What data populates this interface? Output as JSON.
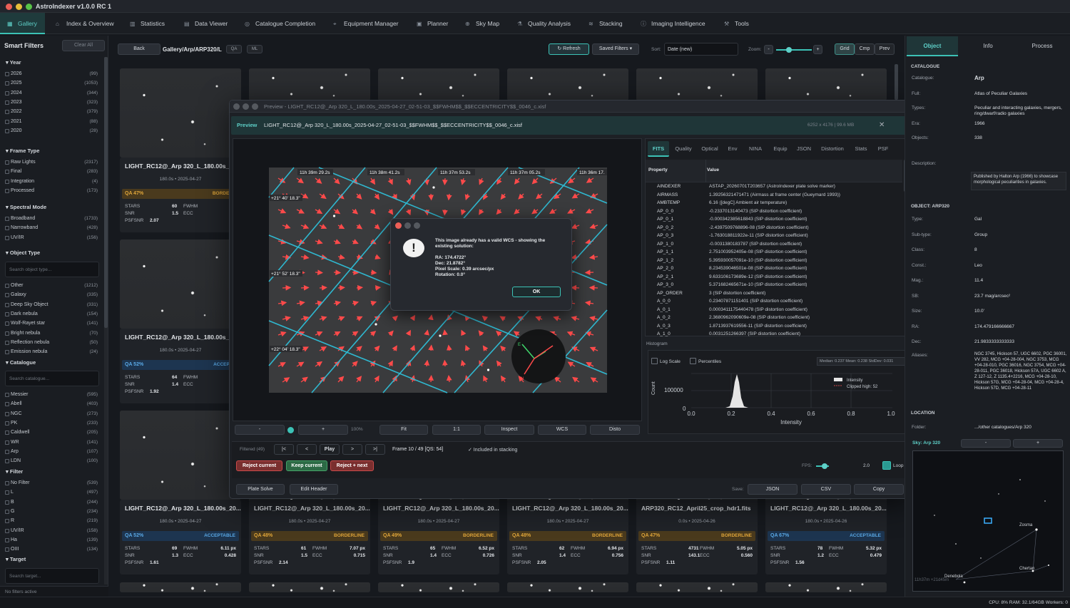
{
  "app": {
    "title": "AstroIndexer v1.0.0 RC 1"
  },
  "tabs": [
    {
      "label": "Gallery",
      "icon": "grid-icon"
    },
    {
      "label": "Index & Overview",
      "icon": "home-icon"
    },
    {
      "label": "Statistics",
      "icon": "bars-icon"
    },
    {
      "label": "Data Viewer",
      "icon": "doc-icon"
    },
    {
      "label": "Catalogue Completion",
      "icon": "target-icon"
    },
    {
      "label": "Equipment Manager",
      "icon": "telescope-icon"
    },
    {
      "label": "Planner",
      "icon": "calendar-icon"
    },
    {
      "label": "Sky Map",
      "icon": "globe-icon"
    },
    {
      "label": "Quality Analysis",
      "icon": "flask-icon"
    },
    {
      "label": "Stacking",
      "icon": "layers-icon"
    },
    {
      "label": "Imaging Intelligence",
      "icon": "info-icon"
    },
    {
      "label": "Tools",
      "icon": "wrench-icon"
    }
  ],
  "sidebar": {
    "title": "Smart Filters",
    "clear_all": "Clear All",
    "year": {
      "label": "Year",
      "items": [
        [
          "2026",
          "(99)"
        ],
        [
          "2025",
          "(1053)"
        ],
        [
          "2024",
          "(344)"
        ],
        [
          "2023",
          "(323)"
        ],
        [
          "2022",
          "(379)"
        ],
        [
          "2021",
          "(88)"
        ],
        [
          "2020",
          "(28)"
        ]
      ]
    },
    "frame_type": {
      "label": "Frame Type",
      "items": [
        [
          "Raw Lights",
          "(2317)"
        ],
        [
          "Final",
          "(283)"
        ],
        [
          "Integration",
          "(4)"
        ],
        [
          "Processed",
          "(173)"
        ]
      ]
    },
    "spectral": {
      "label": "Spectral Mode",
      "items": [
        [
          "Broadband",
          "(1733)"
        ],
        [
          "Narrowband",
          "(428)"
        ],
        [
          "UV/IR",
          "(156)"
        ]
      ]
    },
    "object_type": {
      "label": "Object Type",
      "search": "Search object type...",
      "items": [
        [
          "Other",
          "(1212)"
        ],
        [
          "Galaxy",
          "(335)"
        ],
        [
          "Deep Sky Object",
          "(331)"
        ],
        [
          "Dark nebula",
          "(154)"
        ],
        [
          "Wolf-Rayet star",
          "(141)"
        ],
        [
          "Bright nebula",
          "(70)"
        ],
        [
          "Reflection nebula",
          "(50)"
        ],
        [
          "Emission nebula",
          "(24)"
        ]
      ]
    },
    "catalogue": {
      "label": "Catalogue",
      "search": "Search catalogue...",
      "items": [
        [
          "Messier",
          "(595)"
        ],
        [
          "Abell",
          "(403)"
        ],
        [
          "NGC",
          "(273)"
        ],
        [
          "PK",
          "(233)"
        ],
        [
          "Caldwell",
          "(205)"
        ],
        [
          "WR",
          "(141)"
        ],
        [
          "Arp",
          "(107)"
        ],
        [
          "LDN",
          "(100)"
        ]
      ]
    },
    "filter": {
      "label": "Filter",
      "items": [
        [
          "No Filter",
          "(539)"
        ],
        [
          "L",
          "(497)"
        ],
        [
          "B",
          "(244)"
        ],
        [
          "G",
          "(234)"
        ],
        [
          "R",
          "(219)"
        ],
        [
          "UV/IR",
          "(158)"
        ],
        [
          "Ha",
          "(139)"
        ],
        [
          "OIII",
          "(134)"
        ]
      ]
    },
    "target": {
      "label": "Target",
      "search": "Search target..."
    },
    "footer": "No filters active"
  },
  "toolbar": {
    "back": "Back",
    "path": "Gallery/Arp/ARP320/L",
    "qa": "QA",
    "ml": "ML",
    "refresh": "Refresh",
    "saved_filters": "Saved Filters",
    "sort_label": "Sort:",
    "sort_value": "Date (new)",
    "zoom_label": "Zoom:",
    "zoom_minus": "-",
    "zoom_plus": "+",
    "grid": "Grid",
    "cmp": "Cmp",
    "prev": "Prev"
  },
  "cards_left": [
    {
      "name": "LIGHT_RC12@_Arp 320_L_180.00s_2",
      "sub": "180.0s • 2025-04-27",
      "qa": "QA 47%",
      "status": "BORDERL",
      "stars": "60",
      "fwhm": "6.",
      "snr": "1.5",
      "ecc": "",
      "psfsnr": "2.07"
    },
    {
      "name": "LIGHT_RC12@_Arp 320_L_180.00s_2",
      "sub": "180.0s • 2025-04-27",
      "qa": "QA 52%",
      "status": "ACCEPTA",
      "stars": "64",
      "fwhm": "6.",
      "snr": "1.4",
      "ecc": "",
      "psfsnr": "1.92"
    },
    {
      "name": "LIGHT_RC12@_Arp 320_L_180.00s_20...",
      "sub": "180.0s • 2025-04-27",
      "qa": "QA 52%",
      "status": "ACCEPTABLE",
      "stars": "69",
      "fwhm": "6.11 px",
      "snr": "1.3",
      "ecc": "0.428",
      "psfsnr": "1.61"
    }
  ],
  "cards_bottom": [
    {
      "name": "LIGHT_RC12@_Arp 320_L_180.00s_20...",
      "sub": "180.0s • 2025-04-27",
      "qa": "QA 48%",
      "status": "BORDERLINE",
      "stars": "61",
      "fwhm": "7.07 px",
      "snr": "1.5",
      "ecc": "0.715",
      "psfsnr": "2.14"
    },
    {
      "name": "LIGHT_RC12@_Arp 320_L_180.00s_20...",
      "sub": "180.0s • 2025-04-27",
      "qa": "QA 49%",
      "status": "BORDERLINE",
      "stars": "65",
      "fwhm": "6.52 px",
      "snr": "1.4",
      "ecc": "0.726",
      "psfsnr": "1.9"
    },
    {
      "name": "LIGHT_RC12@_Arp 320_L_180.00s_20...",
      "sub": "180.0s • 2025-04-27",
      "qa": "QA 48%",
      "status": "BORDERLINE",
      "stars": "62",
      "fwhm": "6.94 px",
      "snr": "1.4",
      "ecc": "0.756",
      "psfsnr": "2.05"
    },
    {
      "name": "ARP320_RC12_April25_crop_hdr1.fits",
      "sub": "0.0s • 2025-04-26",
      "qa": "QA 47%",
      "status": "BORDERLINE",
      "stars": "4731",
      "fwhm": "5.05 px",
      "snr": "143.1",
      "ecc": "0.560",
      "psfsnr": "1.11"
    },
    {
      "name": "LIGHT_RC12@_Arp 320_L_180.00s_20...",
      "sub": "180.0s • 2025-04-26",
      "qa": "QA 67%",
      "status": "ACCEPTABLE",
      "stars": "78",
      "fwhm": "5.32 px",
      "snr": "1.2",
      "ecc": "0.479",
      "psfsnr": "1.56"
    }
  ],
  "stat_labels": {
    "stars": "STARS",
    "fwhm": "FWHM",
    "snr": "SNR",
    "ecc": "ECC",
    "psfsnr": "PSFSNR"
  },
  "preview": {
    "window_title": "Preview - LIGHT_RC12@_Arp 320_L_180.00s_2025-04-27_02-51-03_$$FWHM$$_$$ECCENTRICITY$$_0046_c.xisf",
    "badge": "Preview",
    "filename": "LIGHT_RC12@_Arp 320_L_180.00s_2025-04-27_02-51-03_$$FWHM$$_$$ECCENTRICITY$$_0046_c.xisf",
    "dims": "6252 x 4176 | 99.6 MB",
    "ra_labels": [
      "11h 39m 29.2s",
      "11h 38m 41.2s",
      "11h 37m 53.2s",
      "11h 37m 05.2s",
      "11h 36m 17."
    ],
    "dec_labels": [
      "+21° 40' 18.3\"",
      "+21° 52' 18.3\"",
      "+22° 04' 18.3\""
    ],
    "dialog": {
      "message": "This image already has a valid WCS - showing the existing solution:",
      "ra": "RA: 174.4722°",
      "dec": "Dec: 21.8782°",
      "scale": "Pixel Scale: 0.39 arcsec/px",
      "rotation": "Rotation: 0.0°",
      "ok": "OK"
    },
    "view_buttons": {
      "minus": "-",
      "plus": "+",
      "zoom": "100%",
      "fit": "Fit",
      "one": "1:1",
      "inspect": "Inspect",
      "wcs": "WCS",
      "disto": "Disto"
    },
    "playback": {
      "filtered": "Filtered (49)",
      "first": "|<",
      "prev": "<",
      "play": "Play",
      "next": ">",
      "last": ">|",
      "frame": "Frame 10 / 49  [QS: 54]",
      "included": "✓ Included in stacking"
    },
    "actions": {
      "reject": "Reject current",
      "keep": "Keep current",
      "reject_next": "Reject + next",
      "fps_label": "FPS:",
      "fps": "2.0",
      "loop": "Loop"
    },
    "bottom": {
      "plate_solve": "Plate Solve",
      "edit_header": "Edit Header",
      "save_label": "Save:",
      "json": "JSON",
      "csv": "CSV",
      "copy": "Copy"
    },
    "tabs": [
      "FITS",
      "Quality",
      "Optical",
      "Env",
      "NINA",
      "Equip",
      "JSON",
      "Distortion",
      "Stats",
      "PSF"
    ],
    "table_headers": [
      "Property",
      "Value"
    ],
    "fits_rows": [
      [
        "AINDEXER",
        "ASTAP_20260701T203657 (AstroIndexer plate solve marker)"
      ],
      [
        "AIRMASS",
        "1.39256321471471 (Airmass at frame center (Gueymard 1993))"
      ],
      [
        "AMBTEMP",
        "6.16 ([degC] Ambient air temperature)"
      ],
      [
        "AP_0_0",
        "-0.2337013140473 (SIP distortion coefficient)"
      ],
      [
        "AP_0_1",
        "-0.000342385618843 (SIP distortion coefficient)"
      ],
      [
        "AP_0_2",
        "-2.4397509768896-08 (SIP distortion coefficient)"
      ],
      [
        "AP_0_3",
        "-1.763018811922e-11 (SIP distortion coefficient)"
      ],
      [
        "AP_1_0",
        "-0.0031380183787 (SIP distortion coefficient)"
      ],
      [
        "AP_1_1",
        "2.751003952405e-08 (SIP distortion coefficient)"
      ],
      [
        "AP_1_2",
        "5.395930057091e-10 (SIP distortion coefficient)"
      ],
      [
        "AP_2_0",
        "8.234539046501e-08 (SIP distortion coefficient)"
      ],
      [
        "AP_2_1",
        "9.633106173689e-12 (SIP distortion coefficient)"
      ],
      [
        "AP_3_0",
        "5.371682465671e-10 (SIP distortion coefficient)"
      ],
      [
        "AP_ORDER",
        "3 (SIP distortion coefficient)"
      ],
      [
        "A_0_0",
        "0.23407871151401 (SIP distortion coefficient)"
      ],
      [
        "A_0_1",
        "0.0003411175440478 (SIP distortion coefficient)"
      ],
      [
        "A_0_2",
        "2.3680962090609e-08 (SIP distortion coefficient)"
      ],
      [
        "A_0_3",
        "1.8713937619556-11 (SIP distortion coefficient)"
      ],
      [
        "A_1_0",
        "0.0031251266397 (SIP distortion coefficient)"
      ]
    ],
    "histogram": {
      "title": "Histogram",
      "log_scale": "Log Scale",
      "percentiles": "Percentiles",
      "stats": "Median: 0.237  Mean: 0.238  StdDev: 0.031",
      "ylabel": "Count",
      "xlabel": "Intensity",
      "ytick": "100000",
      "ytick0": "0",
      "xticks": [
        "0.0",
        "0.2",
        "0.4",
        "0.6",
        "0.8",
        "1.0"
      ],
      "legend_intensity": "Intensity",
      "legend_clipped": "Clipped high: 52"
    }
  },
  "right_panel": {
    "tabs": [
      "Object",
      "Info",
      "Process"
    ],
    "catalogue_section": "CATALOGUE",
    "catalogue_rows": [
      [
        "Catalogue:",
        "Arp"
      ],
      [
        "Full:",
        "Atlas of Peculiar Galaxies"
      ],
      [
        "Types:",
        "Peculiar and interacting galaxies, mergers, ring/dwarf/radio galaxies"
      ],
      [
        "Era:",
        "1966"
      ],
      [
        "Objects:",
        "338"
      ]
    ],
    "description_label": "Description:",
    "description": "Published by Halton Arp (1966) to showcase morphological peculiarities in galaxies.",
    "object_section": "OBJECT: ARP320",
    "object_rows": [
      [
        "Type:",
        "Gal"
      ],
      [
        "Sub-type:",
        "Group"
      ],
      [
        "Class:",
        "8"
      ],
      [
        "Const.:",
        "Leo"
      ],
      [
        "Mag.:",
        "11.4"
      ],
      [
        "SB:",
        "23.7 mag/arcsec²"
      ],
      [
        "Size:",
        "10.0'"
      ],
      [
        "RA:",
        "174.479166666667"
      ],
      [
        "Dec:",
        "21.9833333333333"
      ]
    ],
    "aliases_label": "Aliases:",
    "aliases": "NGC 3745, Hickson 57, UGC 6602, PGC 36001, VV 282, MCG +04-28-004, NGC 3753, MCG +04-28-010, PGC 36016, NGC 3754, MCG +04-28-011, PGC 36018, Hickson 57A, UGC 6602 A, Z 127-12, Z 1135.4+2216, MCG +04-28-10, Hickson 57G, MCG +04-28-04, MCG +04-28-4, Hickson 57D, MCG +04-28-11",
    "location_section": "LOCATION",
    "folder_label": "Folder:",
    "folder": ".../other catalogues/Arp 320",
    "sky_label": "Sky: Arp 320",
    "sky_minus": "-",
    "sky_plus": "+",
    "stars": [
      "Zosma",
      "Chertan",
      "Denebola"
    ],
    "coord": "11h37m +21d45m"
  },
  "statusbar": "CPU: 8%  RAM: 32.1/64GB  Workers: 0",
  "colors": {
    "accent": "#3cc2b6",
    "acceptable": "#5aa9e6",
    "borderline": "#e0a63a",
    "reject": "#c94a4a"
  }
}
